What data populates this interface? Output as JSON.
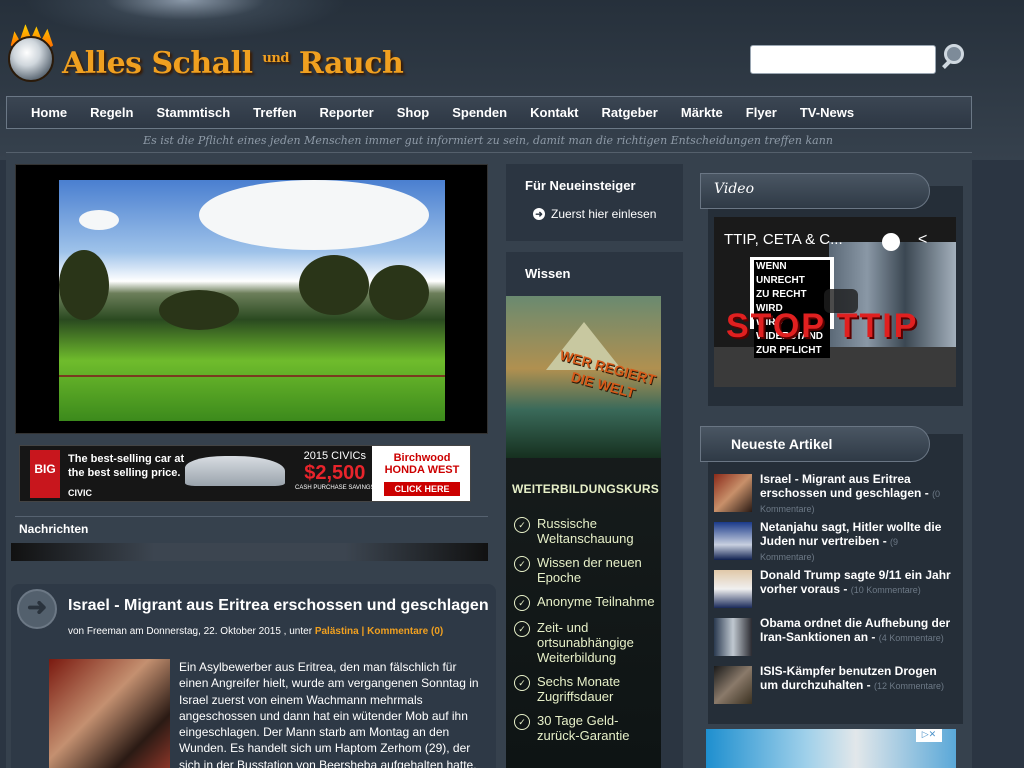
{
  "header": {
    "logo_text_1": "Alles Schall",
    "logo_text_small": "und",
    "logo_text_2": "Rauch",
    "search_placeholder": "",
    "tagline": "Es ist die Pflicht eines jeden Menschen immer gut informiert zu sein, damit man die richtigen Entscheidungen treffen kann"
  },
  "nav": {
    "items": [
      "Home",
      "Regeln",
      "Stammtisch",
      "Treffen",
      "Reporter",
      "Shop",
      "Spenden",
      "Kontakt",
      "Ratgeber",
      "Märkte",
      "Flyer",
      "TV-News"
    ]
  },
  "ad_banner": {
    "logo": "BIG",
    "tagline_1": "The best-selling car at",
    "tagline_2": "the best selling price.",
    "brand": "CIVIC",
    "model": "2015 CIVICs",
    "price": "$2,500",
    "price_note": "CASH PURCHASE SAVINGS",
    "dealer": "Birchwood HONDA WEST",
    "cta": "CLICK HERE"
  },
  "main": {
    "section_title": "Nachrichten",
    "post": {
      "title": "Israel - Migrant aus Eritrea erschossen und geschlagen",
      "meta_prefix": "von Freeman am Donnerstag, 22. Oktober 2015 , unter",
      "category": "Palästina",
      "separator": "|",
      "comments": "Kommentare (0)",
      "body": "Ein Asylbewerber aus Eritrea, den man fälschlich für einen Angreifer hielt, wurde am vergangenen Sonntag in Israel zuerst von einem Wachmann mehrmals angeschossen und dann hat ein wütender Mob auf ihn eingeschlagen. Der Mann starb am Montag an den Wunden. Es handelt sich um Haptom Zerhom (29), der sich in der Busstation von Beersheba aufgehalten hatte,"
    }
  },
  "middle": {
    "box1_title": "Für Neueinsteiger",
    "box1_link": "Zuerst hier einlesen",
    "box2_title": "Wissen",
    "ad": {
      "headline": "WER REGIERT DIE WELT",
      "kurs": "WEITERBILDUNGSKURS",
      "items": [
        "Russische Weltanschauung",
        "Wissen der neuen Epoche",
        "Anonyme Teilnahme",
        "Zeit- und ortsunabhängige Weiterbildung",
        "Sechs Monate Zugriffsdauer",
        "30 Tage Geld-zurück-Garantie"
      ]
    }
  },
  "right": {
    "video_title": "Video",
    "video": {
      "title": "TTIP, CETA & C...",
      "sign_1": "WENN UNRECHT",
      "sign_2": "ZU RECHT WIRD",
      "sign_3": "WIRD WIDERSTAND",
      "sign_4": "ZUR PFLICHT",
      "banner": "STOP TTIP"
    },
    "articles_title": "Neueste Artikel",
    "articles": [
      {
        "title": "Israel - Migrant aus Eritrea erschossen und geschlagen",
        "comments": "(0 Kommentare)"
      },
      {
        "title": "Netanjahu sagt, Hitler wollte die Juden nur vertreiben",
        "comments": "(9 Kommentare)"
      },
      {
        "title": "Donald Trump sagte 9/11 ein Jahr vorher voraus",
        "comments": "(10 Kommentare)"
      },
      {
        "title": "Obama ordnet die Aufhebung der Iran-Sanktionen an",
        "comments": "(4 Kommentare)"
      },
      {
        "title": "ISIS-Kämpfer benutzen Drogen um durchzuhalten",
        "comments": "(12 Kommentare)"
      }
    ]
  },
  "colors": {
    "background": "#2b3542",
    "accent": "#f0a020",
    "panel": "#2b3541"
  }
}
